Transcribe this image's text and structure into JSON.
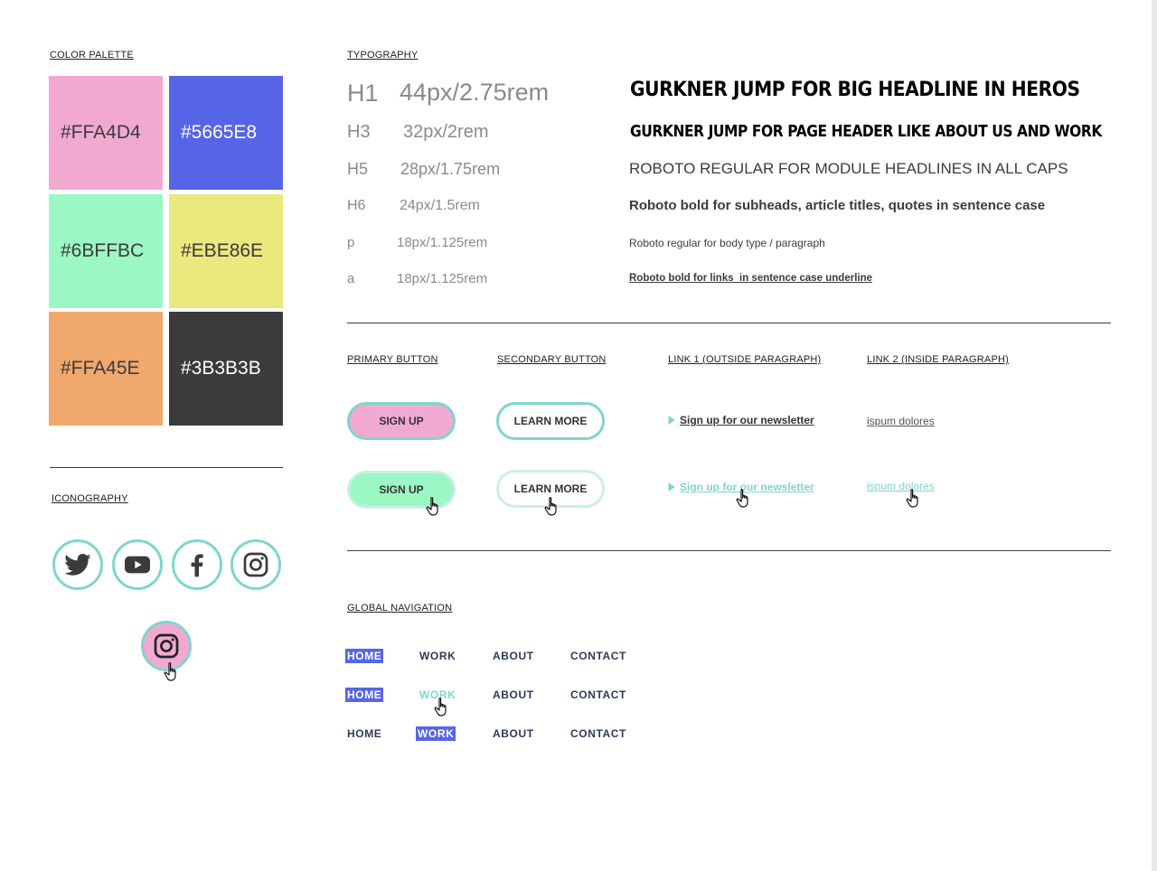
{
  "palette": {
    "title": "COLOR PALETTE",
    "swatches": [
      {
        "label": "#FFA4D4",
        "color": "#f1a9d2",
        "text": "#3b3b3b"
      },
      {
        "label": "#5665E8",
        "color": "#5665e8",
        "text": "#ffffff"
      },
      {
        "label": "#6BFFBC",
        "color": "#9bf7c3",
        "text": "#3b3b3b"
      },
      {
        "label": "#EBE86E",
        "color": "#ebe87e",
        "text": "#3b3b3b"
      },
      {
        "label": "#FFA45E",
        "color": "#f0a86c",
        "text": "#3b3b3b"
      },
      {
        "label": "#3B3B3B",
        "color": "#3b3b3b",
        "text": "#ffffff"
      }
    ]
  },
  "iconography": {
    "title": "ICONOGRAPHY",
    "icons": [
      "twitter-icon",
      "youtube-icon",
      "facebook-icon",
      "instagram-icon"
    ],
    "hover_icon": "instagram-icon",
    "hover_fill": "#f1a9d2",
    "border_color": "#7fd6cc"
  },
  "typography": {
    "title": "TYPOGRAPHY",
    "rows": [
      {
        "tag": "H1",
        "size": "44px/2.75rem",
        "desc": "Gurkner Jump for big headline in heros"
      },
      {
        "tag": "H3",
        "size": "32px/2rem",
        "desc": "Gurkner Jump for page header like about us and work"
      },
      {
        "tag": "H5",
        "size": "28px/1.75rem",
        "desc": "ROBOTO REGULAR FOR MODULE HEADLINES IN ALL CAPS"
      },
      {
        "tag": "H6",
        "size": "24px/1.5rem",
        "desc": "Roboto bold for subheads, article titles, quotes in sentence case"
      },
      {
        "tag": "p",
        "size": "18px/1.125rem",
        "desc": "Roboto regular for body type / paragraph"
      },
      {
        "tag": "a",
        "size": "18px/1.125rem",
        "desc": "Roboto bold for links  in sentence case underline"
      }
    ]
  },
  "buttons": {
    "primary_title": "PRIMARY BUTTON",
    "secondary_title": "SECONDARY BUTTON",
    "link1_title": "LINK 1 (OUTSIDE PARAGRAPH)",
    "link2_title": "LINK 2 (INSIDE PARAGRAPH)",
    "primary_label": "SIGN UP",
    "secondary_label": "LEARN MORE",
    "link1_label": "Sign up for our newsletter",
    "link2_label": "ispum dolores",
    "accent": "#7fd6cc",
    "primary_fill": "#f1a9d2",
    "primary_hover_fill": "#9bf7c3"
  },
  "navigation": {
    "title": "GLOBAL NAVIGATION",
    "items": [
      "HOME",
      "WORK",
      "ABOUT",
      "CONTACT"
    ],
    "active_color": "#5665e8",
    "hover_color": "#7fd6cc"
  }
}
